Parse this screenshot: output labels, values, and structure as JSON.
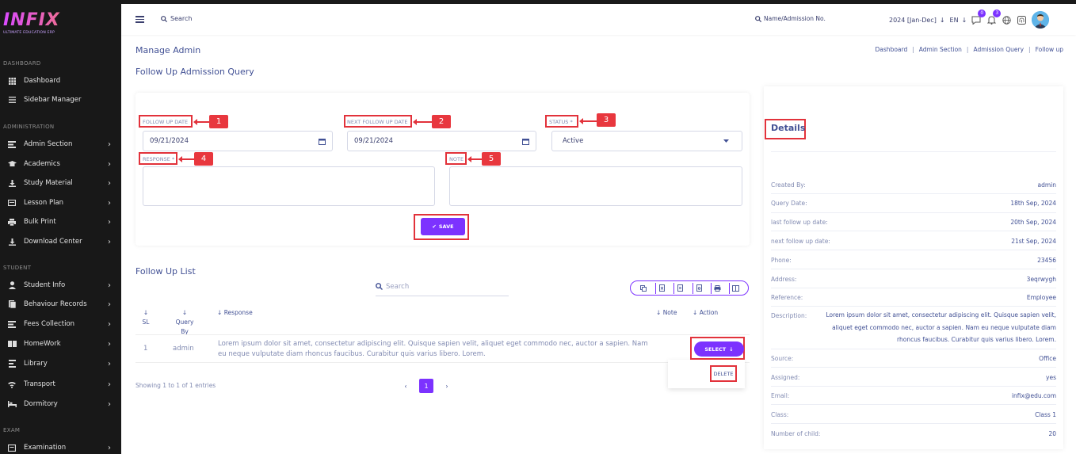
{
  "logo": {
    "text": "INFIX",
    "subtitle": "ULTIMATE EDUCATION ERP"
  },
  "sidebar": {
    "sections": {
      "dashboard": "DASHBOARD",
      "administration": "ADMINISTRATION",
      "student": "STUDENT",
      "exam": "EXAM"
    },
    "items": [
      {
        "label": "Dashboard",
        "icon": "grid-icon"
      },
      {
        "label": "Sidebar Manager",
        "icon": "list-icon"
      },
      {
        "label": "Admin Section",
        "icon": "admin-icon"
      },
      {
        "label": "Academics",
        "icon": "graduation-cap-icon"
      },
      {
        "label": "Study Material",
        "icon": "download-icon"
      },
      {
        "label": "Lesson Plan",
        "icon": "clipboard-icon"
      },
      {
        "label": "Bulk Print",
        "icon": "print-icon"
      },
      {
        "label": "Download Center",
        "icon": "download-icon"
      },
      {
        "label": "Student Info",
        "icon": "user-icon"
      },
      {
        "label": "Behaviour Records",
        "icon": "records-icon"
      },
      {
        "label": "Fees Collection",
        "icon": "fees-icon"
      },
      {
        "label": "HomeWork",
        "icon": "book-icon"
      },
      {
        "label": "Library",
        "icon": "library-icon"
      },
      {
        "label": "Transport",
        "icon": "bus-icon"
      },
      {
        "label": "Dormitory",
        "icon": "bed-icon"
      },
      {
        "label": "Examination",
        "icon": "exam-icon"
      }
    ]
  },
  "header": {
    "search_label": "Search",
    "name_admission_label": "Name/Admission No.",
    "year": "2024 [Jan-Dec]",
    "language": "EN",
    "messages_count": "0",
    "notifications_count": "3"
  },
  "page": {
    "title": "Manage Admin",
    "subtitle": "Follow Up Admission Query",
    "breadcrumb": [
      "Dashboard",
      "Admin Section",
      "Admission Query",
      "Follow up"
    ]
  },
  "form": {
    "follow_up_date_label": "FOLLOW UP DATE",
    "follow_up_date_value": "09/21/2024",
    "next_follow_up_date_label": "NEXT FOLLOW UP DATE",
    "next_follow_up_date_value": "09/21/2024",
    "status_label": "STATUS *",
    "status_value": "Active",
    "response_label": "RESPONSE *",
    "note_label": "NOTE",
    "save_label": "SAVE",
    "callouts": [
      "1",
      "2",
      "3",
      "4",
      "5"
    ]
  },
  "list": {
    "title": "Follow Up List",
    "search_placeholder": "Search",
    "columns": {
      "sl": "SL",
      "query_by": "Query By",
      "response": "Response",
      "note": "Note",
      "action": "Action"
    },
    "rows": [
      {
        "sl": "1",
        "query_by": "admin",
        "response_line1": "Lorem ipsum dolor sit amet, consectetur adipiscing elit. Quisque sapien velit, aliquet eget commodo nec, auctor a sapien. Nam",
        "response_line2": "eu neque vulputate diam rhoncus faucibus. Curabitur quis varius libero. Lorem."
      }
    ],
    "select_label": "SELECT",
    "delete_label": "DELETE",
    "showing": "Showing 1 to 1 of 1 entries",
    "current_page": "1"
  },
  "details": {
    "title": "Details",
    "fields": [
      {
        "key": "Created By:",
        "value": "admin"
      },
      {
        "key": "Query Date:",
        "value": "18th Sep, 2024"
      },
      {
        "key": "last follow up date:",
        "value": "20th Sep, 2024"
      },
      {
        "key": "next follow up date:",
        "value": "21st Sep, 2024"
      },
      {
        "key": "Phone:",
        "value": "23456"
      },
      {
        "key": "Address:",
        "value": "3eqrwygh"
      },
      {
        "key": "Reference:",
        "value": "Employee"
      },
      {
        "key": "Description:",
        "value": "Lorem ipsum dolor sit amet, consectetur adipiscing elit. Quisque sapien velit, aliquet eget commodo nec, auctor a sapien. Nam eu neque vulputate diam rhoncus faucibus. Curabitur quis varius libero. Lorem."
      },
      {
        "key": "Source:",
        "value": "Office"
      },
      {
        "key": "Assigned:",
        "value": "yes"
      },
      {
        "key": "Email:",
        "value": "infix@edu.com"
      },
      {
        "key": "Class:",
        "value": "Class 1"
      },
      {
        "key": "Number of child:",
        "value": "20"
      }
    ]
  },
  "colors": {
    "accent": "#7c32ff",
    "sidebar_bg": "#181818",
    "annotation_red": "#e2323b",
    "text_primary": "#415094"
  }
}
